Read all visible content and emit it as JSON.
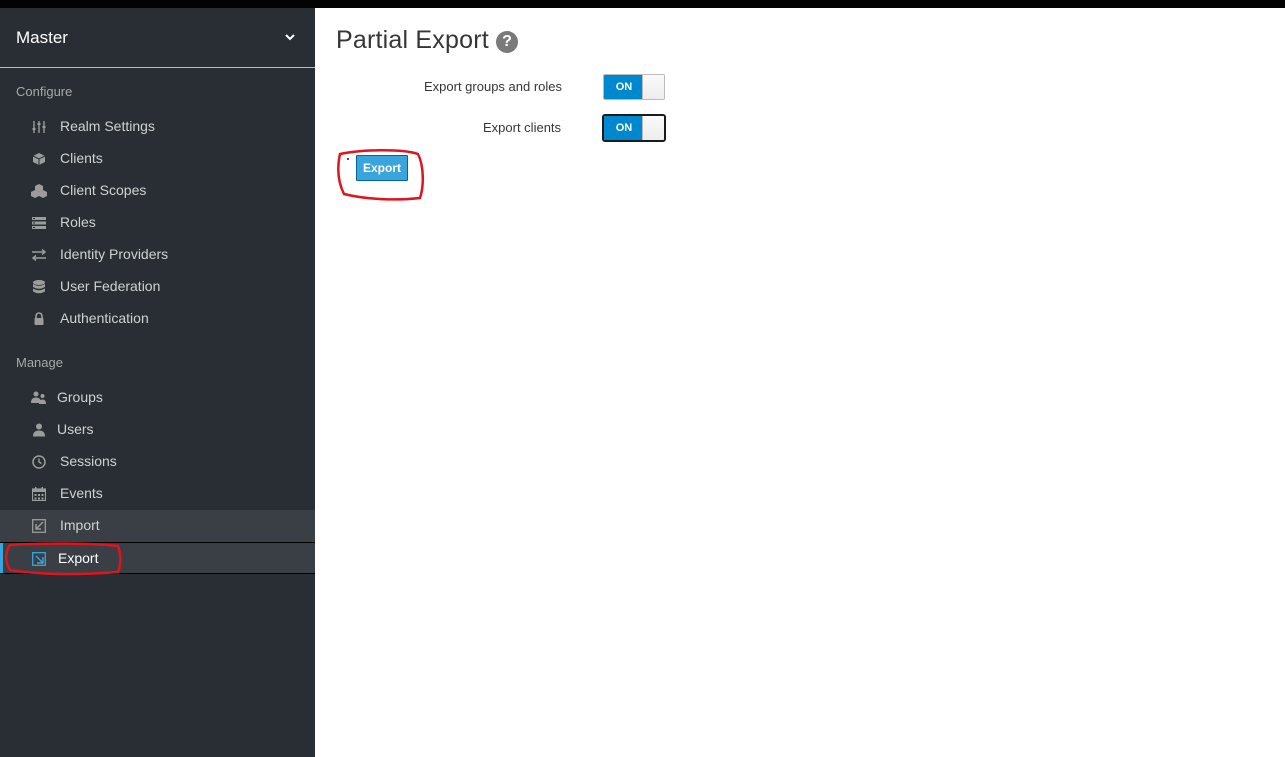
{
  "sidebar": {
    "realm": "Master",
    "sections": {
      "configure": "Configure",
      "manage": "Manage"
    },
    "configure_items": [
      {
        "label": "Realm Settings",
        "icon": "sliders-icon"
      },
      {
        "label": "Clients",
        "icon": "cube-icon"
      },
      {
        "label": "Client Scopes",
        "icon": "cubes-icon"
      },
      {
        "label": "Roles",
        "icon": "list-icon"
      },
      {
        "label": "Identity Providers",
        "icon": "exchange-icon"
      },
      {
        "label": "User Federation",
        "icon": "database-icon"
      },
      {
        "label": "Authentication",
        "icon": "lock-icon"
      }
    ],
    "manage_items": [
      {
        "label": "Groups",
        "icon": "users-icon"
      },
      {
        "label": "Users",
        "icon": "user-icon"
      },
      {
        "label": "Sessions",
        "icon": "clock-icon"
      },
      {
        "label": "Events",
        "icon": "calendar-icon"
      },
      {
        "label": "Import",
        "icon": "import-icon"
      },
      {
        "label": "Export",
        "icon": "export-icon",
        "active": true
      }
    ]
  },
  "main": {
    "title": "Partial Export",
    "help": "?",
    "options": [
      {
        "label": "Export groups and roles",
        "toggle": "ON"
      },
      {
        "label": "Export clients",
        "toggle": "ON"
      }
    ],
    "export_button": "Export"
  },
  "colors": {
    "sidebar_bg": "#292e34",
    "accent": "#39a5dc",
    "toggle_on": "#0088ce",
    "annotation": "#e0141e"
  }
}
